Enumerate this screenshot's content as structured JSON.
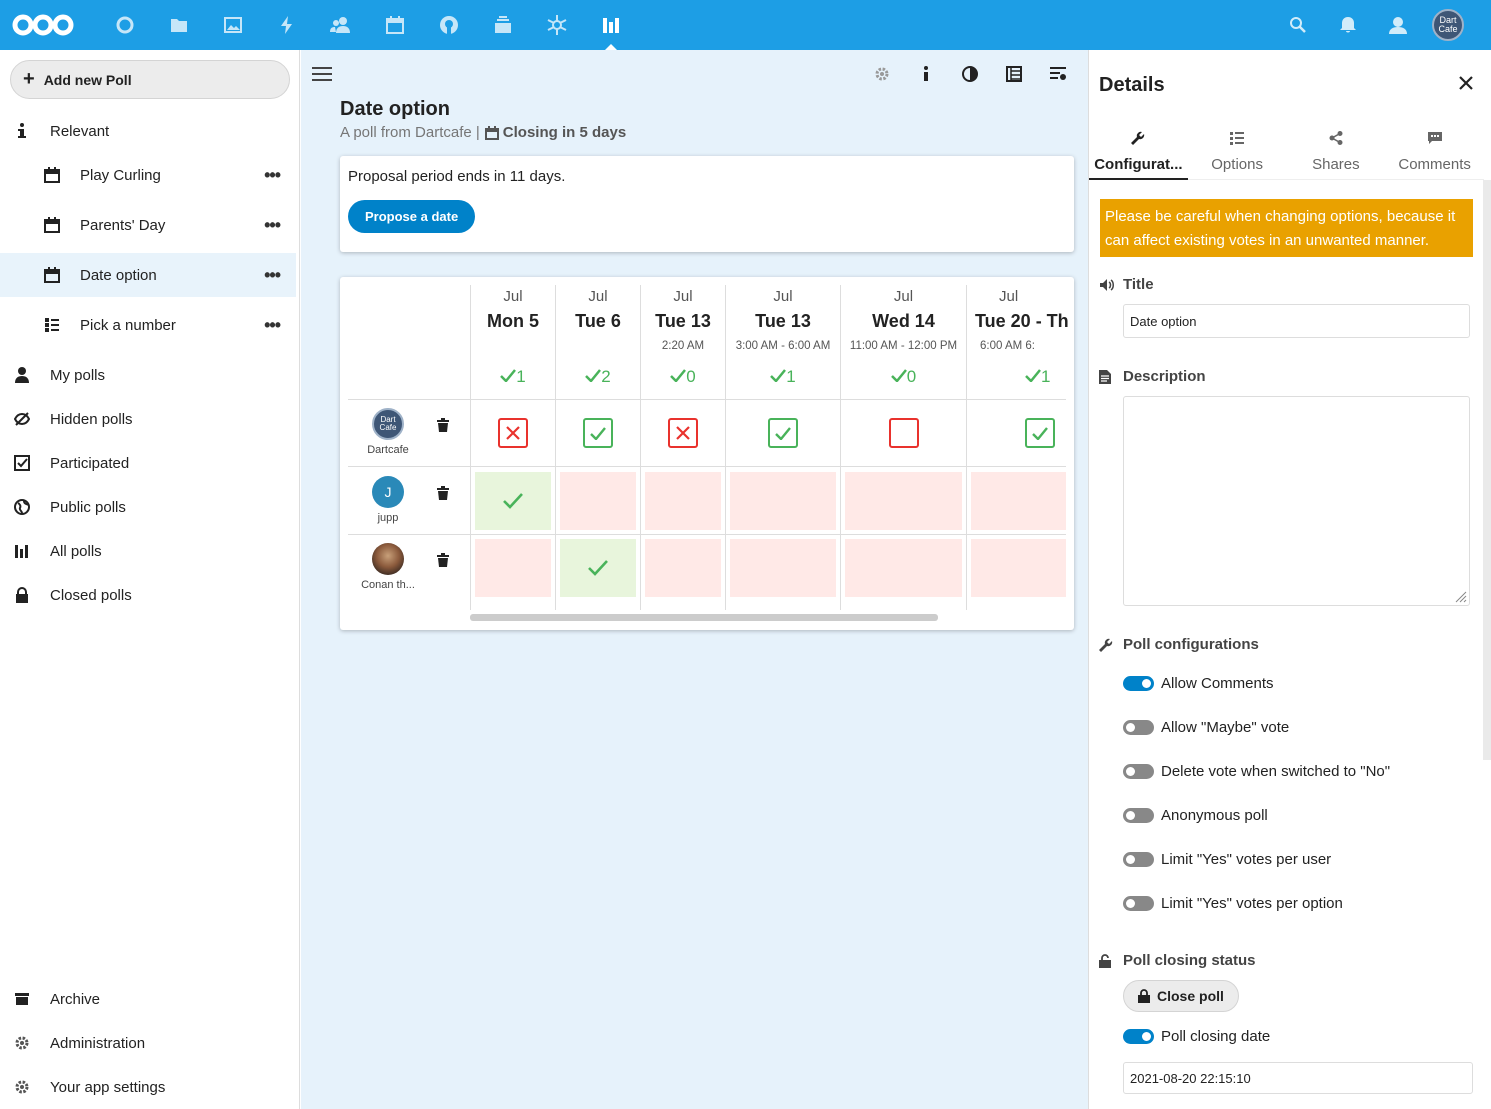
{
  "topbar": {
    "apps": [
      "dashboard-icon",
      "files-icon",
      "photos-icon",
      "activity-icon",
      "contacts-icon",
      "calendar-icon",
      "github-icon",
      "deck-icon",
      "integration-icon",
      "polls-icon"
    ],
    "avatar_text": "Dart Cafe",
    "accent": "#1d9ee5"
  },
  "sidebar": {
    "new_poll": "Add new Poll",
    "relevant": "Relevant",
    "polls": [
      {
        "label": "Play Curling"
      },
      {
        "label": "Parents' Day"
      },
      {
        "label": "Date option"
      },
      {
        "label": "Pick a number"
      }
    ],
    "sections": [
      {
        "label": "My polls"
      },
      {
        "label": "Hidden polls"
      },
      {
        "label": "Participated"
      },
      {
        "label": "Public polls"
      },
      {
        "label": "All polls"
      },
      {
        "label": "Closed polls"
      }
    ],
    "bottom": [
      {
        "label": "Archive"
      },
      {
        "label": "Administration"
      },
      {
        "label": "Your app settings"
      }
    ]
  },
  "poll": {
    "title": "Date option",
    "from": "A poll from Dartcafe |",
    "closing": "Closing in 5 days",
    "proposal_text": "Proposal period ends in 11 days.",
    "propose_btn": "Propose a date",
    "options": [
      {
        "month": "Jul",
        "day": "Mon 5",
        "time": "",
        "count": "1"
      },
      {
        "month": "Jul",
        "day": "Tue 6",
        "time": "",
        "count": "2"
      },
      {
        "month": "Jul",
        "day": "Tue 13",
        "time": "2:20 AM",
        "count": "0"
      },
      {
        "month": "Jul",
        "day": "Tue 13",
        "time": "3:00 AM  -  6:00 AM",
        "count": "1"
      },
      {
        "month": "Jul",
        "day": "Wed 14",
        "time": "11:00 AM  -  12:00 PM",
        "count": "0"
      },
      {
        "month": "Jul",
        "day": "Tue 20  -  Th",
        "time": "6:00 AM                6:",
        "count": "1"
      }
    ],
    "participants": [
      {
        "name": "Dartcafe",
        "avatar_text": "Dart Cafe"
      },
      {
        "name": "J",
        "display": "jupp"
      },
      {
        "name": "Conan th..."
      }
    ]
  },
  "details": {
    "title": "Details",
    "tabs": [
      "Configurat...",
      "Options",
      "Shares",
      "Comments"
    ],
    "warning": "Please be careful when changing options, because it can affect existing votes in an unwanted manner.",
    "title_label": "Title",
    "title_value": "Date option",
    "description_label": "Description",
    "config_label": "Poll configurations",
    "toggles": [
      {
        "label": "Allow Comments"
      },
      {
        "label": "Allow \"Maybe\" vote"
      },
      {
        "label": "Delete vote when switched to \"No\""
      },
      {
        "label": "Anonymous poll"
      },
      {
        "label": "Limit \"Yes\" votes per user"
      },
      {
        "label": "Limit \"Yes\" votes per option"
      }
    ],
    "closing_label": "Poll closing status",
    "close_btn": "Close poll",
    "closing_date_label": "Poll closing date",
    "closing_date_value": "2021-08-20 22:15:10"
  }
}
